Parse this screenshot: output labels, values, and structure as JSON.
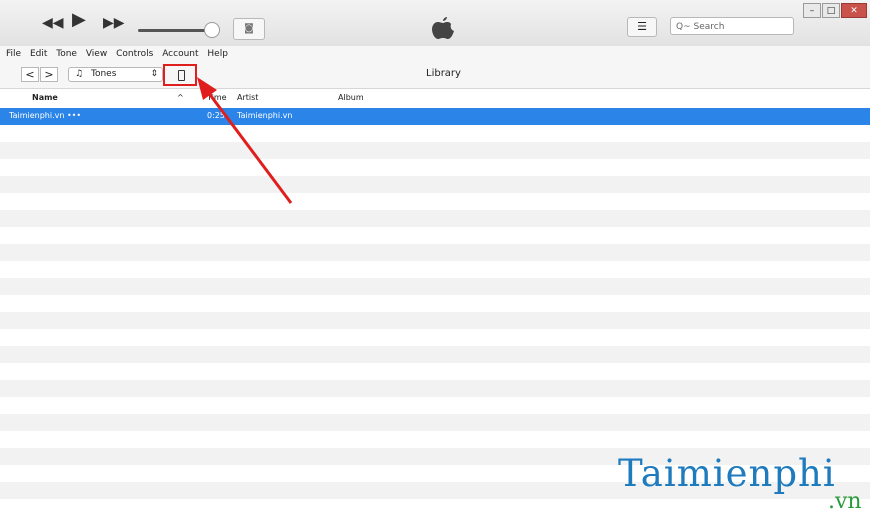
{
  "player": {
    "rewind_icon": "rewind-icon",
    "play_icon": "play-icon",
    "forward_icon": "fast-forward-icon",
    "airplay_icon": "airplay-icon"
  },
  "search": {
    "placeholder": "Q~ Search"
  },
  "menu": [
    "File",
    "Edit",
    "Tone",
    "View",
    "Controls",
    "Account",
    "Help"
  ],
  "toolbar": {
    "back": "<",
    "forward": ">",
    "media_type": "Tones",
    "library_label": "Library"
  },
  "columns": {
    "name": "Name",
    "time": "Time",
    "artist": "Artist",
    "album": "Album"
  },
  "rows": [
    {
      "name": "Taimienphi.vn •••",
      "time": "0:25",
      "artist": "Taimienphi.vn",
      "album": ""
    }
  ],
  "watermark": {
    "main": "Taimienphi",
    "suffix": ".vn"
  },
  "colors": {
    "selection": "#2b84e8",
    "highlight_box": "#e01e1e",
    "arrow": "#e01e1e"
  }
}
